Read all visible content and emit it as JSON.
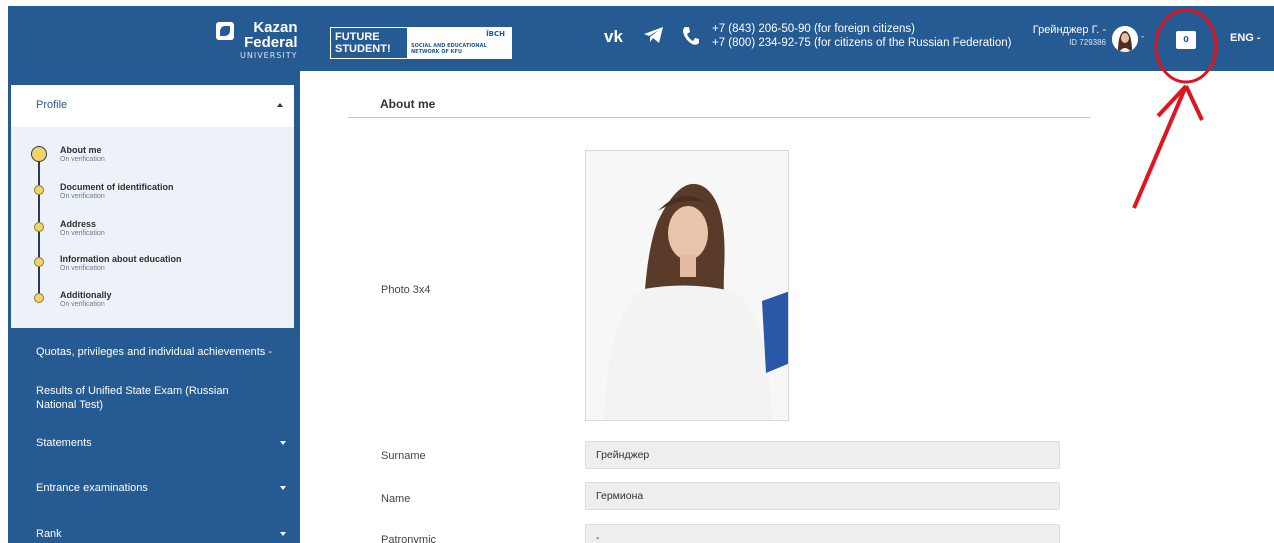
{
  "header": {
    "logo": {
      "line1": "Kazan",
      "line2": "Federal",
      "line3": "UNIVERSITY"
    },
    "future": {
      "text": "FUTURE STUDENT!",
      "brand": "ÏBCH",
      "network": "SOCIAL AND EDUCATIONAL NETWORK OF KFU"
    },
    "phones": [
      "+7 (843) 206-50-90 (for foreign citizens)",
      "+7 (800) 234-92-75 (for citizens of the Russian Federation)"
    ],
    "user": {
      "name": "Грейнджер Г. -",
      "id": "ID 729386"
    },
    "avatar_caret": "-",
    "messages_count": "0",
    "language": "ENG -",
    "icons": [
      "vk-icon",
      "telegram-icon",
      "phone-icon",
      "message-icon"
    ]
  },
  "sidebar": {
    "profile": {
      "title": "Profile"
    },
    "steps": [
      {
        "title": "About me",
        "status": "On verification"
      },
      {
        "title": "Document of identification",
        "status": "On verification"
      },
      {
        "title": "Address",
        "status": "On verification"
      },
      {
        "title": "Information about education",
        "status": "On verification"
      },
      {
        "title": "Additionally",
        "status": "On verification"
      }
    ],
    "items": [
      {
        "label": "Quotas, privileges and individual achievements -"
      },
      {
        "label": "Results of Unified State Exam (Russian National Test)"
      },
      {
        "label": "Statements"
      },
      {
        "label": "Entrance examinations"
      },
      {
        "label": "Rank"
      }
    ]
  },
  "main": {
    "section_title": "About me",
    "photo_label": "Photo 3x4",
    "fields": [
      {
        "label": "Surname",
        "value": "Грейнджер"
      },
      {
        "label": "Name",
        "value": "Гермиона"
      },
      {
        "label": "Patronymic",
        "value": "-"
      }
    ]
  },
  "colors": {
    "brand": "#265a93",
    "annotation": "#e0141e",
    "step_dot": "#f0d36a"
  }
}
